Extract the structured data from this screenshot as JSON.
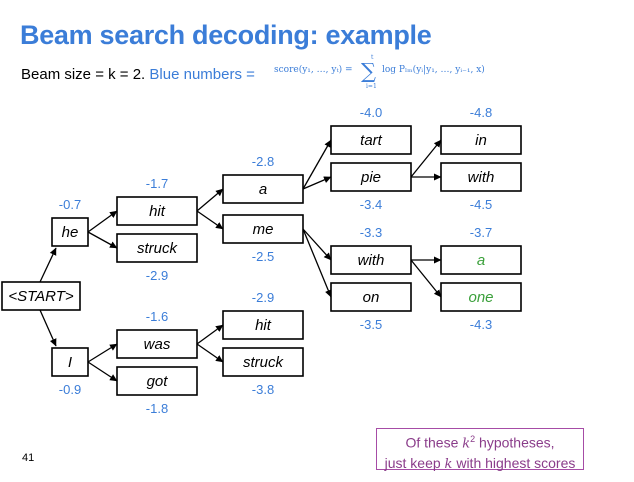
{
  "slide": {
    "title": "Beam search decoding: example",
    "subtitle_prefix": "Beam size = k = 2.",
    "subtitle_blue": "Blue numbers =",
    "formula": {
      "lhs": "score(y₁, …, yₜ) =",
      "sum_upper": "t",
      "sum_lower": "i=1",
      "rhs": "log Pₗₘ(yᵢ|y₁, …, yᵢ₋₁, x)"
    },
    "page_number": "41",
    "callout": {
      "line1_pre": "Of these ",
      "line1_var": "k",
      "line1_sup": "2",
      "line1_post": " hypotheses,",
      "line2_pre": "just keep ",
      "line2_var": "k",
      "line2_post": " with highest scores"
    }
  },
  "tree": {
    "nodes": [
      {
        "id": "start",
        "word": "<START>",
        "score": ""
      },
      {
        "id": "he",
        "word": "he",
        "score": "-0.7"
      },
      {
        "id": "I",
        "word": "I",
        "score": "-0.9"
      },
      {
        "id": "hit1",
        "word": "hit",
        "score": "-1.7"
      },
      {
        "id": "struck1",
        "word": "struck",
        "score": "-2.9"
      },
      {
        "id": "was",
        "word": "was",
        "score": "-1.6"
      },
      {
        "id": "got",
        "word": "got",
        "score": "-1.8"
      },
      {
        "id": "a1",
        "word": "a",
        "score": "-2.8"
      },
      {
        "id": "me",
        "word": "me",
        "score": "-2.5"
      },
      {
        "id": "hit2",
        "word": "hit",
        "score": "-2.9"
      },
      {
        "id": "struck2",
        "word": "struck",
        "score": "-3.8"
      },
      {
        "id": "tart",
        "word": "tart",
        "score": "-4.0"
      },
      {
        "id": "pie",
        "word": "pie",
        "score": "-3.4"
      },
      {
        "id": "with1",
        "word": "with",
        "score": "-3.3"
      },
      {
        "id": "on",
        "word": "on",
        "score": "-3.5"
      },
      {
        "id": "in",
        "word": "in",
        "score": "-4.8"
      },
      {
        "id": "with2",
        "word": "with",
        "score": "-4.5"
      },
      {
        "id": "a2",
        "word": "a",
        "score": "-3.7"
      },
      {
        "id": "one",
        "word": "one",
        "score": "-4.3"
      }
    ],
    "edges": [
      [
        "start",
        "he"
      ],
      [
        "start",
        "I"
      ],
      [
        "he",
        "hit1"
      ],
      [
        "he",
        "struck1"
      ],
      [
        "I",
        "was"
      ],
      [
        "I",
        "got"
      ],
      [
        "hit1",
        "a1"
      ],
      [
        "hit1",
        "me"
      ],
      [
        "was",
        "hit2"
      ],
      [
        "was",
        "struck2"
      ],
      [
        "a1",
        "tart"
      ],
      [
        "a1",
        "pie"
      ],
      [
        "me",
        "with1"
      ],
      [
        "me",
        "on"
      ],
      [
        "pie",
        "in"
      ],
      [
        "pie",
        "with2"
      ],
      [
        "with1",
        "a2"
      ],
      [
        "with1",
        "one"
      ]
    ],
    "colors": {
      "score": "#3b7dd8",
      "final_word": "#3ba03b",
      "callout": "#a64ca6",
      "title": "#3b7dd8"
    }
  }
}
